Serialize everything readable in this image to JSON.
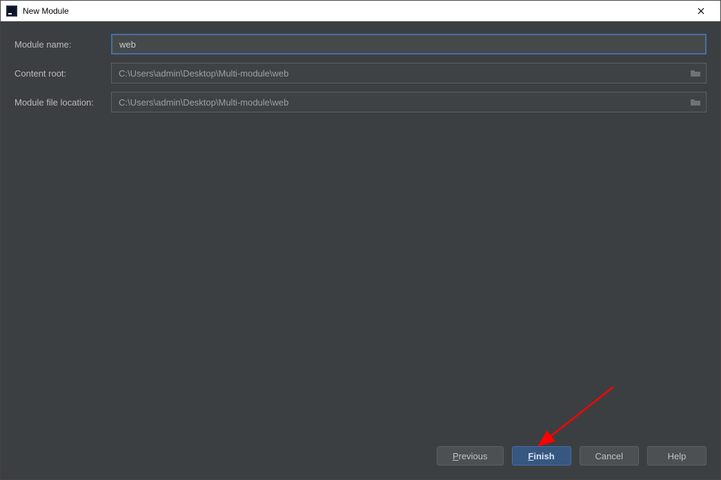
{
  "window": {
    "title": "New Module"
  },
  "form": {
    "module_name": {
      "label": "Module name:",
      "value": "web"
    },
    "content_root": {
      "label": "Content root:",
      "value": "C:\\Users\\admin\\Desktop\\Multi-module\\web"
    },
    "module_file_location": {
      "label": "Module file location:",
      "value": "C:\\Users\\admin\\Desktop\\Multi-module\\web"
    }
  },
  "buttons": {
    "previous": {
      "mn": "P",
      "rest": "revious"
    },
    "finish": {
      "mn": "F",
      "rest": "inish"
    },
    "cancel": {
      "label": "Cancel"
    },
    "help": {
      "label": "Help"
    }
  }
}
